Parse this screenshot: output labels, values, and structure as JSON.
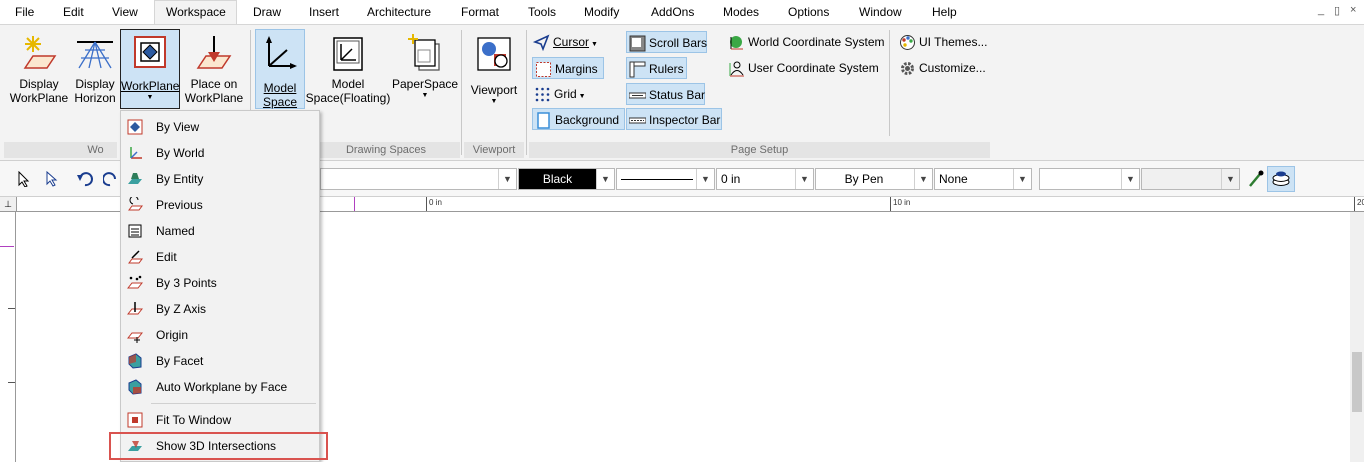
{
  "menubar": {
    "items": [
      "File",
      "Edit",
      "View",
      "Workspace",
      "Draw",
      "Insert",
      "Architecture",
      "Format",
      "Tools",
      "Modify",
      "AddOns",
      "Modes",
      "Options",
      "Window",
      "Help"
    ],
    "active": "Workspace",
    "window_controls": [
      "_",
      "▯",
      "×"
    ]
  },
  "ribbon": {
    "workplane_group": {
      "display_workplane": "Display WorkPlane",
      "display_horizon": "Display Horizon",
      "workplane": "WorkPlane",
      "place_on_workplane": "Place on WorkPlane",
      "label": "Wo"
    },
    "drawing_spaces": {
      "model_space": "Model Space",
      "model_space_floating": "Model Space(Floating)",
      "paperspace": "PaperSpace",
      "label": "Drawing Spaces"
    },
    "viewport": {
      "label_button": "Viewport",
      "label": "Viewport"
    },
    "page_setup": {
      "cursor": "Cursor",
      "margins": "Margins",
      "grid": "Grid",
      "background": "Background",
      "scroll_bars": "Scroll Bars",
      "rulers": "Rulers",
      "status_bar": "Status Bar",
      "inspector_bar": "Inspector Bar",
      "world_cs": "World Coordinate System",
      "user_cs": "User Coordinate System",
      "label": "Page Setup"
    },
    "misc": {
      "ui_themes": "UI Themes...",
      "customize": "Customize..."
    }
  },
  "toolbar": {
    "color": "Black",
    "line_width": "0 in",
    "pen": "By Pen",
    "fill": "None"
  },
  "ruler": {
    "mark0": "0 in",
    "mark10": "10 in",
    "mark20": "20"
  },
  "dropdown": {
    "items": [
      {
        "label": "By View",
        "icon": "view-icon"
      },
      {
        "label": "By World",
        "icon": "world-axes-icon"
      },
      {
        "label": "By Entity",
        "icon": "entity-icon"
      },
      {
        "label": "Previous",
        "icon": "previous-icon"
      },
      {
        "label": "Named",
        "icon": "named-icon"
      },
      {
        "label": "Edit",
        "icon": "edit-icon"
      },
      {
        "label": "By 3 Points",
        "icon": "three-points-icon"
      },
      {
        "label": "By Z Axis",
        "icon": "z-axis-icon"
      },
      {
        "label": "Origin",
        "icon": "origin-icon"
      },
      {
        "label": "By Facet",
        "icon": "facet-icon"
      },
      {
        "label": "Auto Workplane by Face",
        "icon": "auto-face-icon"
      }
    ],
    "items2": [
      {
        "label": "Fit To Window",
        "icon": "fit-window-icon"
      },
      {
        "label": "Show 3D Intersections",
        "icon": "intersections-icon"
      }
    ]
  },
  "colors": {
    "accent": "#cde3f5",
    "highlight": "#d9534f",
    "ribbon": "#f3f3f3"
  }
}
